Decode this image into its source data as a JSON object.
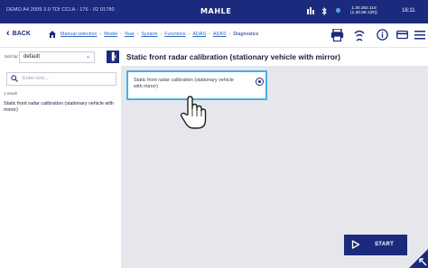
{
  "statusbar": {
    "vehicle": "DEMO A4 2009 3.0 TDI CCLA - 176 - 02 01780",
    "logo": "MAHLE",
    "ip_line1": "1.30.282.118",
    "ip_line2": "(1.30.98.1(R))",
    "clock": "16:11",
    "icons": [
      "sim-icon",
      "bluetooth-icon",
      "wifi-icon"
    ]
  },
  "nav": {
    "back_label": "BACK",
    "crumbs": [
      "Manual selection",
      "Model",
      "Year",
      "System",
      "Functions",
      "ADAS",
      "ADAS"
    ],
    "current": "Diagnostics",
    "icons": [
      "printer-icon",
      "signal-icon",
      "info-icon",
      "card-icon",
      "menu-icon"
    ]
  },
  "filter": {
    "sort_label": "Sort by:",
    "sort_value": "default"
  },
  "page": {
    "title": "Static front radar calibration (stationary vehicle with mirror)"
  },
  "sidebar": {
    "search_placeholder": "Enter text...",
    "result_count": "1 result",
    "results": [
      "Static front radar calibration (stationary vehicle with mirror)"
    ]
  },
  "main": {
    "option_label": "Static front radar calibration (stationary vehicle with mirror)",
    "option_selected": true,
    "start_label": "START"
  },
  "colors": {
    "brand": "#1c2a7d",
    "selection": "#48aee5",
    "link": "#2b66c6",
    "panel": "#e5e7ec"
  }
}
